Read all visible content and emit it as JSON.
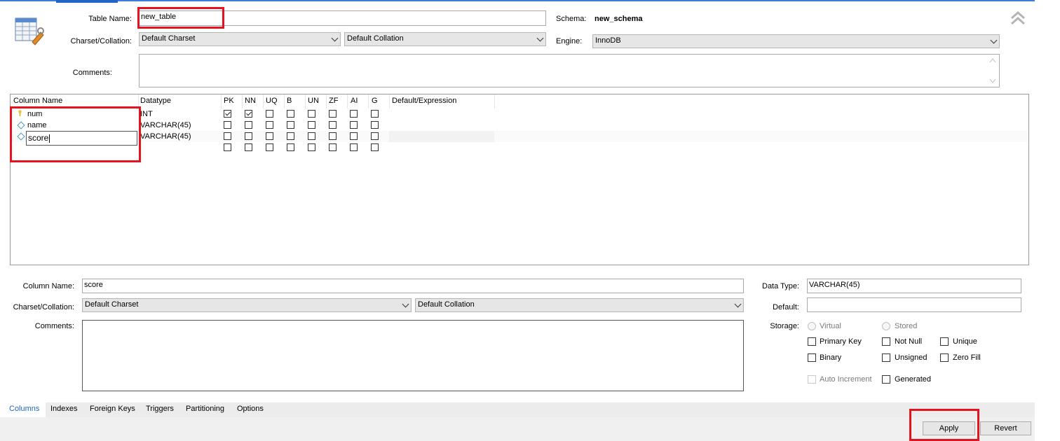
{
  "header": {
    "table_name_label": "Table Name:",
    "table_name_value": "new_table",
    "schema_label": "Schema:",
    "schema_value": "new_schema",
    "charset_label": "Charset/Collation:",
    "charset_value": "Default Charset",
    "collation_value": "Default Collation",
    "engine_label": "Engine:",
    "engine_value": "InnoDB",
    "comments_label": "Comments:"
  },
  "grid": {
    "headers": [
      "Column Name",
      "Datatype",
      "PK",
      "NN",
      "UQ",
      "B",
      "UN",
      "ZF",
      "AI",
      "G",
      "Default/Expression"
    ],
    "rows": [
      {
        "name": "num",
        "datatype": "INT",
        "flags": [
          true,
          true,
          false,
          false,
          false,
          false,
          false,
          false
        ]
      },
      {
        "name": "name",
        "datatype": "VARCHAR(45)",
        "flags": [
          false,
          false,
          false,
          false,
          false,
          false,
          false,
          false
        ]
      },
      {
        "name": "score",
        "datatype": "VARCHAR(45)",
        "flags": [
          false,
          false,
          false,
          false,
          false,
          false,
          false,
          false
        ]
      },
      {
        "name": "",
        "datatype": "",
        "flags": [
          false,
          false,
          false,
          false,
          false,
          false,
          false,
          false
        ]
      }
    ]
  },
  "details": {
    "column_name_label": "Column Name:",
    "column_name_value": "score",
    "charset_label": "Charset/Collation:",
    "charset_value": "Default Charset",
    "collation_value": "Default Collation",
    "comments_label": "Comments:",
    "data_type_label": "Data Type:",
    "data_type_value": "VARCHAR(45)",
    "default_label": "Default:",
    "storage_label": "Storage:",
    "virtual": "Virtual",
    "stored": "Stored",
    "primary_key": "Primary Key",
    "not_null": "Not Null",
    "unique": "Unique",
    "binary": "Binary",
    "unsigned": "Unsigned",
    "zero_fill": "Zero Fill",
    "auto_increment": "Auto Increment",
    "generated": "Generated"
  },
  "tabs": [
    "Columns",
    "Indexes",
    "Foreign Keys",
    "Triggers",
    "Partitioning",
    "Options"
  ],
  "buttons": {
    "apply": "Apply",
    "revert": "Revert"
  },
  "colors": {
    "accent": "#2166c5",
    "highlight": "#e3131f"
  }
}
